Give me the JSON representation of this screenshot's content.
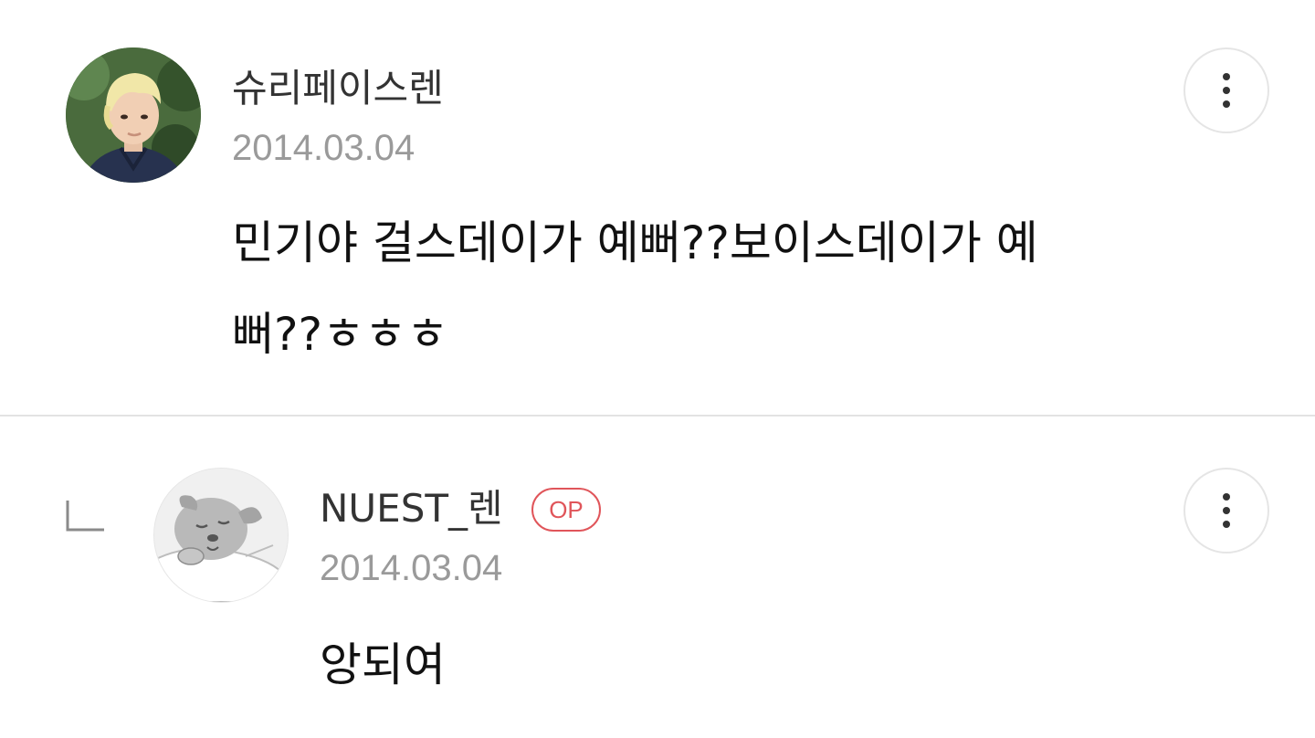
{
  "comments": [
    {
      "author": "슈리페이스렌",
      "date": "2014.03.04",
      "text": "민기야 걸스데이가 예뻐??보이스데이가 예\n뻐??ㅎㅎㅎ",
      "avatar_icon": "profile-photo-blonde-person",
      "menu_icon": "more-vertical-icon"
    },
    {
      "author": "NUEST_렌",
      "badge": "OP",
      "date": "2014.03.04",
      "text": "앙되여",
      "avatar_icon": "sleeping-dog-character-icon",
      "reply_icon": "reply-indent-icon",
      "menu_icon": "more-vertical-icon"
    }
  ],
  "colors": {
    "op_badge": "#e0555a",
    "date_text": "#9a9a9a",
    "divider": "#e3e3e3"
  }
}
